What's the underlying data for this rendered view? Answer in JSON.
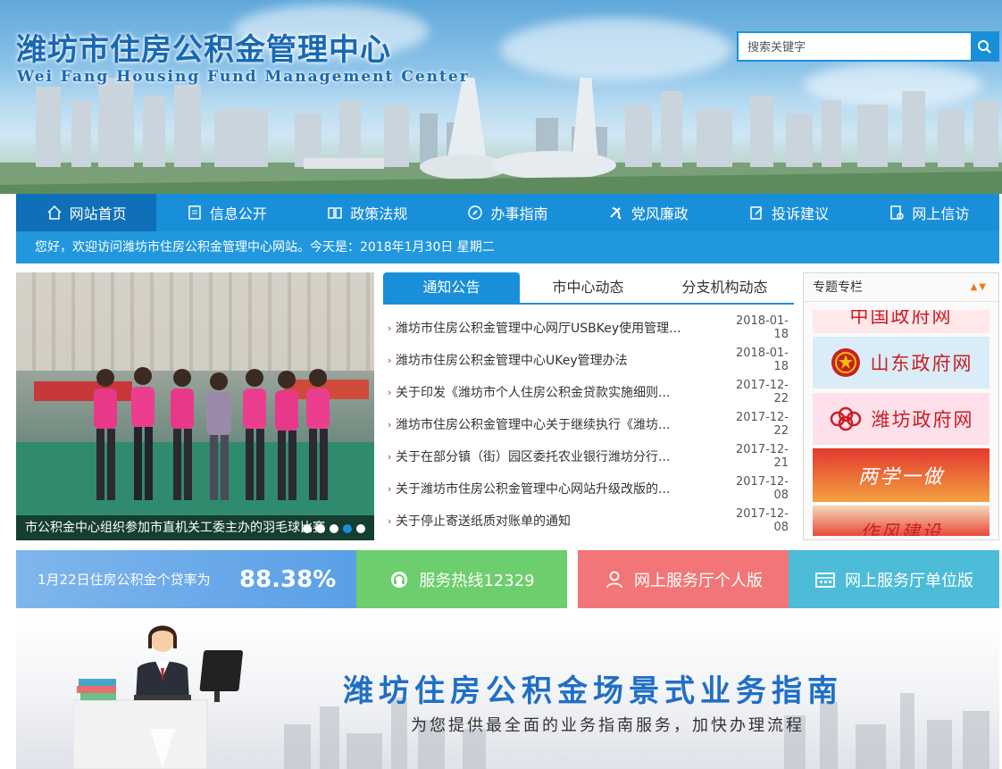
{
  "header": {
    "title_cn": "潍坊市住房公积金管理中心",
    "title_en": "Wei Fang Housing Fund Management Center",
    "search_placeholder": "搜索关键字"
  },
  "nav": {
    "items": [
      {
        "label": "网站首页",
        "icon": "home-icon"
      },
      {
        "label": "信息公开",
        "icon": "document-icon"
      },
      {
        "label": "政策法规",
        "icon": "book-icon"
      },
      {
        "label": "办事指南",
        "icon": "compass-icon"
      },
      {
        "label": "党风廉政",
        "icon": "party-emblem-icon"
      },
      {
        "label": "投诉建议",
        "icon": "edit-icon"
      },
      {
        "label": "网上信访",
        "icon": "letter-icon"
      }
    ]
  },
  "welcome": "您好，欢迎访问潍坊市住房公积金管理中心网站。今天是：2018年1月30日 星期二",
  "slider": {
    "caption": "市公积金中心组织参加市直机关工委主办的羽毛球比赛",
    "dots": 5,
    "active_dot": 4
  },
  "news": {
    "tabs": [
      "通知公告",
      "市中心动态",
      "分支机构动态"
    ],
    "items": [
      {
        "title": "潍坊市住房公积金管理中心网厅USBKey使用管理...",
        "date": "2018-01-18"
      },
      {
        "title": "潍坊市住房公积金管理中心UKey管理办法",
        "date": "2018-01-18"
      },
      {
        "title": "关于印发《潍坊市个人住房公积金贷款实施细则...",
        "date": "2017-12-22"
      },
      {
        "title": "潍坊市住房公积金管理中心关于继续执行《潍坊...",
        "date": "2017-12-22"
      },
      {
        "title": "关于在部分镇（街）园区委托农业银行潍坊分行...",
        "date": "2017-12-21"
      },
      {
        "title": "关于潍坊市住房公积金管理中心网站升级改版的...",
        "date": "2017-12-08"
      },
      {
        "title": "关于停止寄送纸质对账单的通知",
        "date": "2017-12-08"
      }
    ]
  },
  "special": {
    "title": "专题专栏",
    "cards": [
      "中国政府网",
      "山东政府网",
      "潍坊政府网",
      "两学一做",
      "作风建设"
    ]
  },
  "services": {
    "rate_label": "1月22日住房公积金个贷率为",
    "rate_value": "88.38%",
    "hotline": "服务热线12329",
    "personal": "网上服务厅个人版",
    "company": "网上服务厅单位版"
  },
  "guide": {
    "title": "潍坊住房公积金场景式业务指南",
    "subtitle": "为您提供最全面的业务指南服务，加快办理流程"
  },
  "colors": {
    "primary": "#1a8fd9",
    "hotline": "#6cce6c",
    "personal": "#f27677",
    "company": "#4cbcd8"
  }
}
